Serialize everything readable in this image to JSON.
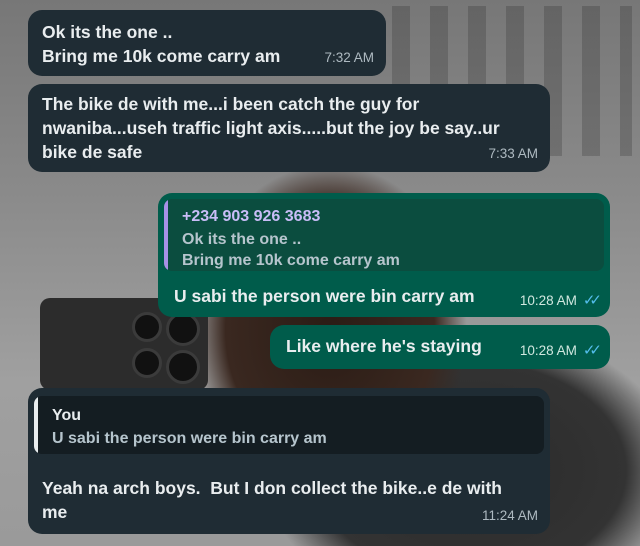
{
  "colors": {
    "incoming_bubble": "#1f2c34",
    "outgoing_bubble": "#005c4b",
    "quote_incoming_bg": "#141d22",
    "quote_outgoing_bg": "#0b4d3f",
    "read_ticks": "#53bdeb",
    "quote_contact_bar": "#a791e6",
    "quote_you_bar": "#e9edef"
  },
  "icons": {
    "read_receipt": "double-check-icon"
  },
  "messages": [
    {
      "direction": "incoming",
      "text": "Ok its the one ..\nBring me 10k come carry am",
      "time": "7:32 AM"
    },
    {
      "direction": "incoming",
      "text": "The bike de with me...i been catch the guy for\nnwaniba...useh traffic light axis.....but the joy be say..ur\nbike de safe",
      "time": "7:33 AM"
    },
    {
      "direction": "outgoing",
      "quote": {
        "sender": "+234 903 926 3683",
        "text": "Ok its the one ..\nBring me 10k come carry am"
      },
      "text": "U sabi the person were bin carry am",
      "time": "10:28 AM",
      "status": "read"
    },
    {
      "direction": "outgoing",
      "text": "Like where he's staying",
      "time": "10:28 AM",
      "status": "read"
    },
    {
      "direction": "incoming",
      "quote": {
        "sender": "You",
        "text": "U sabi the person were bin carry am"
      },
      "text": "Yeah na arch boys.  But I don collect the bike..e de with\nme",
      "time": "11:24 AM"
    }
  ]
}
